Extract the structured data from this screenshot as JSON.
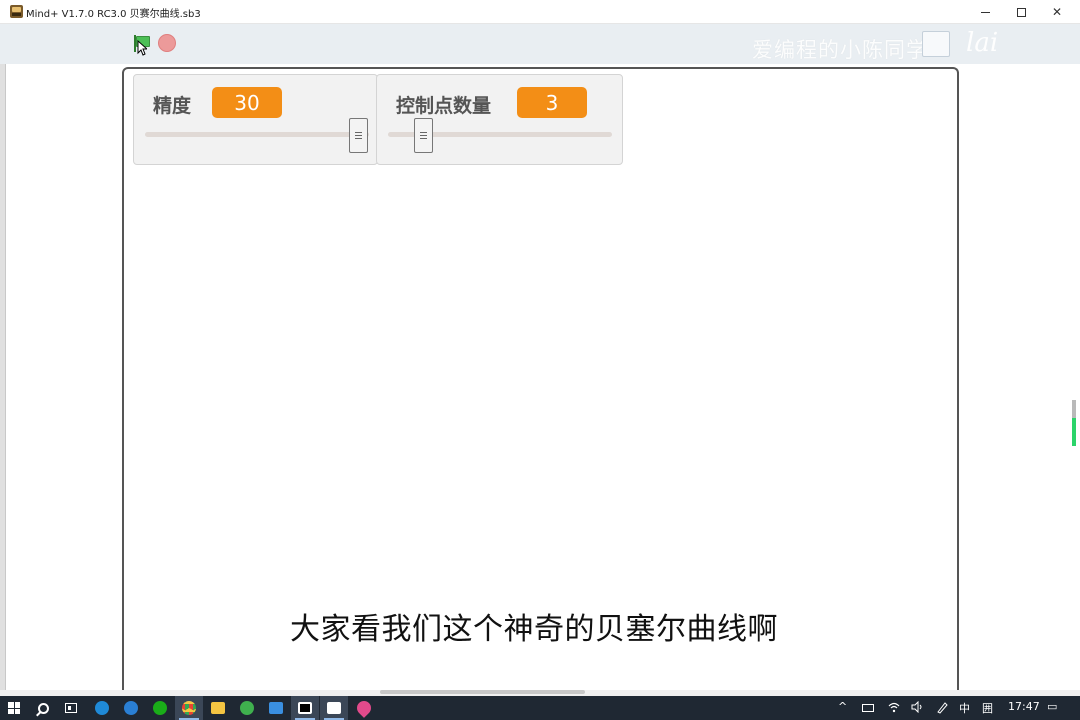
{
  "window": {
    "title": "Mind+ V1.7.0 RC3.0   贝赛尔曲线.sb3",
    "minimize_glyph": "",
    "maximize_glyph": "",
    "close_glyph": "✕"
  },
  "toolbar": {
    "watermark": "爱编程的小陈同学",
    "watermark_logo": "lai"
  },
  "monitors": [
    {
      "label": "精度",
      "value": "30",
      "slider_fraction": 0.95
    },
    {
      "label": "控制点数量",
      "value": "3",
      "slider_fraction": 0.1
    }
  ],
  "subtitle": "大家看我们这个神奇的贝塞尔曲线啊",
  "taskbar": {
    "tray": {
      "chevron": "^",
      "ime_lang": "中",
      "ime_mode": "囲",
      "clock": "17:47",
      "notification_glyph": "▭"
    },
    "apps": [
      {
        "name": "edge-icon",
        "color": "#1f8ad8"
      },
      {
        "name": "ie-icon",
        "color": "#2a7fd4"
      },
      {
        "name": "wechat-icon",
        "color": "#1aad19"
      },
      {
        "name": "chrome-icon",
        "color": "#e84335"
      },
      {
        "name": "file-explorer-icon",
        "color": "#f4c542"
      },
      {
        "name": "browser-green-icon",
        "color": "#3fb04e"
      },
      {
        "name": "app-blue-icon",
        "color": "#3a8fe0"
      },
      {
        "name": "capcut-icon",
        "color": "#ffffff"
      },
      {
        "name": "mindplus-icon",
        "color": "#ffffff"
      },
      {
        "name": "drop-icon",
        "color": "#e24a8b"
      }
    ]
  },
  "colors": {
    "accent_orange": "#f38e16",
    "flag_green": "#4cbf56",
    "stop_red": "#ec9a9a"
  }
}
